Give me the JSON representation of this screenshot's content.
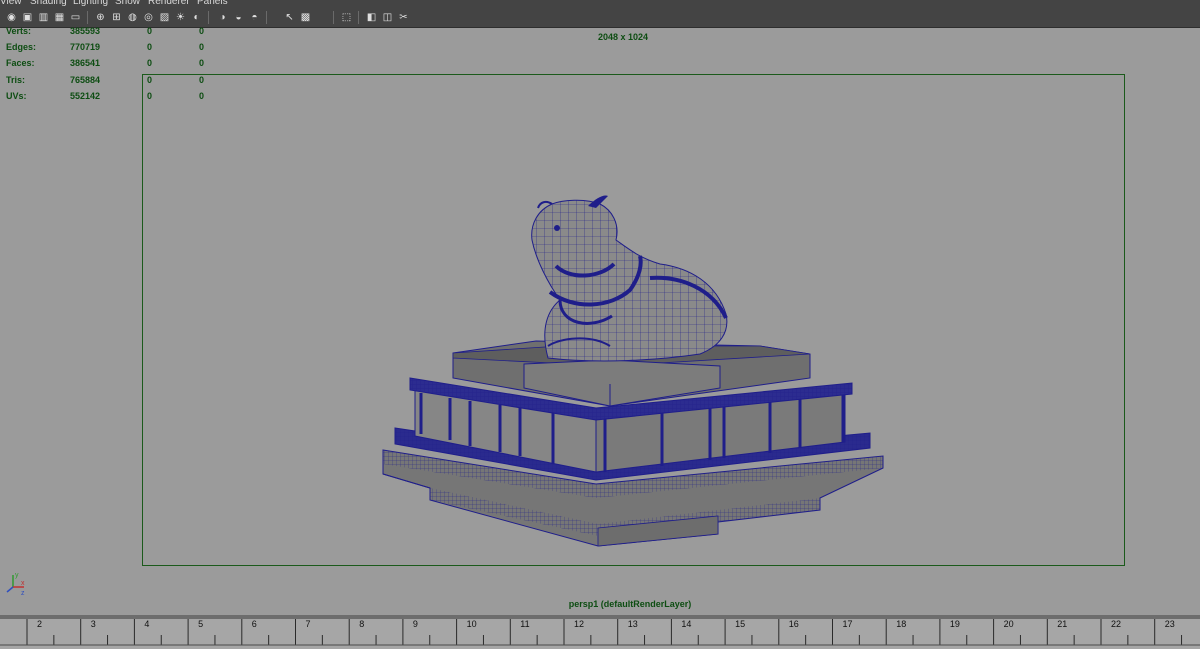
{
  "menu": [
    "View",
    "Shading",
    "Lighting",
    "Show",
    "Renderer",
    "Panels"
  ],
  "toolbar": {
    "icons": [
      "camera-attributes-icon",
      "bookmark-icon",
      "image-plane-icon",
      "grid-icon",
      "film-gate-icon",
      "resolution-gate-icon",
      "wireframe-icon",
      "smooth-shade-icon",
      "wireframe-on-shaded-icon",
      "texture-icon",
      "lights-icon",
      "shadows-icon",
      "xray-icon",
      "xray-joints-icon",
      "xray-components-icon",
      "default-material-icon",
      "bounding-box-icon",
      "isolate-select-icon",
      "shaded-box-icon",
      "wireframe-box-icon",
      "hypershade-icon"
    ],
    "glyphs": [
      "◉",
      "▣",
      "▥",
      "▦",
      "▭",
      "⊕",
      "⊞",
      "◍",
      "◎",
      "▨",
      "☀",
      "◐",
      "◑",
      "◒",
      "◓",
      "↖",
      "▩",
      "⬚",
      "◧",
      "◫",
      "✂"
    ]
  },
  "hud": {
    "rows": [
      {
        "label": "Verts:",
        "v1": "385593",
        "v2": "0",
        "v3": "0"
      },
      {
        "label": "Edges:",
        "v1": "770719",
        "v2": "0",
        "v3": "0"
      },
      {
        "label": "Faces:",
        "v1": "386541",
        "v2": "0",
        "v3": "0"
      },
      {
        "label": "Tris:",
        "v1": "765884",
        "v2": "0",
        "v3": "0"
      },
      {
        "label": "UVs:",
        "v1": "552142",
        "v2": "0",
        "v3": "0"
      }
    ]
  },
  "viewport": {
    "resolution": "2048 x 1024",
    "camera": "persp1 (defaultRenderLayer)",
    "axes": {
      "x": "x",
      "y": "y",
      "z": "z"
    }
  },
  "timeline": {
    "ticks": [
      "2",
      "3",
      "4",
      "5",
      "6",
      "7",
      "8",
      "9",
      "10",
      "11",
      "12",
      "13",
      "14",
      "15",
      "16",
      "17",
      "18",
      "19",
      "20",
      "21",
      "22",
      "23"
    ]
  },
  "colors": {
    "wire": "#1f1e8a",
    "shade": "#7d7d7d",
    "hud_text": "#0d4d12",
    "gate": "#1b5a1b"
  }
}
